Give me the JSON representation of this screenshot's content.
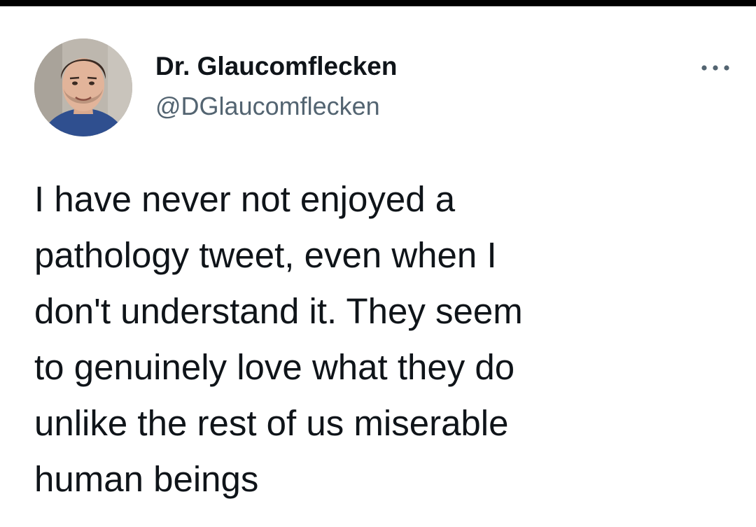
{
  "author": {
    "display_name": "Dr. Glaucomflecken",
    "handle": "@DGlaucomflecken",
    "avatar_icon": "profile-photo"
  },
  "menu": {
    "more_icon": "more-horizontal-icon"
  },
  "tweet": {
    "lines": [
      "I have never not enjoyed a",
      "pathology tweet, even when I",
      "don't understand it. They seem",
      "to genuinely love what they do",
      "unlike the rest of us miserable",
      "human beings"
    ]
  },
  "colors": {
    "text": "#0f1419",
    "secondary_text": "#536471",
    "background": "#ffffff",
    "top_bar": "#000000"
  }
}
